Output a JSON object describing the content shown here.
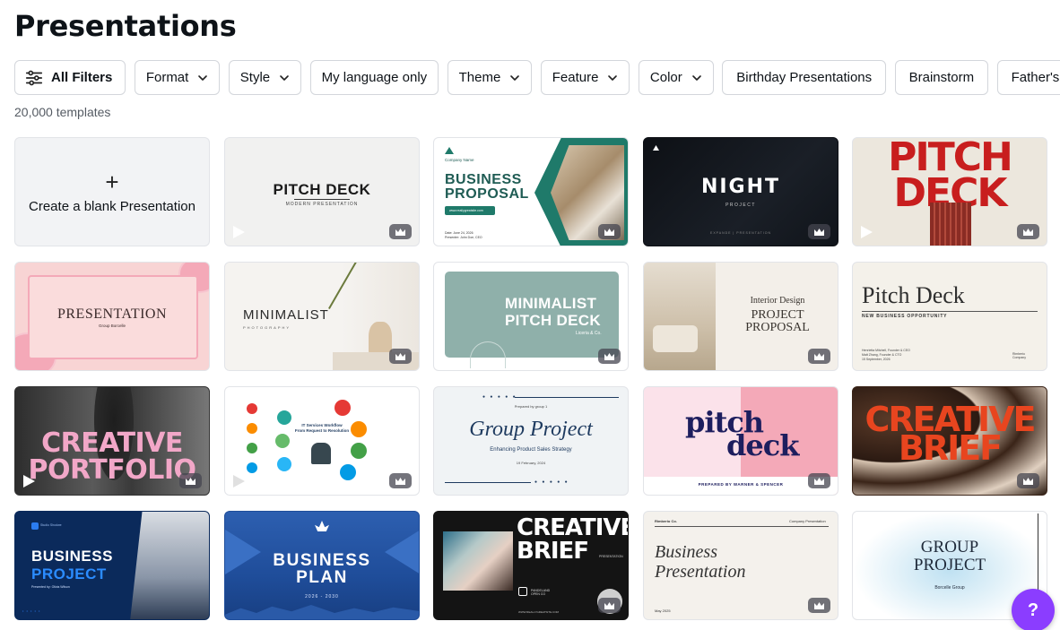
{
  "page": {
    "title": "Presentations",
    "count": "20,000 templates"
  },
  "filters": {
    "all_filters": "All Filters",
    "dropdowns": [
      "Format",
      "Style"
    ],
    "my_language": "My language only",
    "dropdowns2": [
      "Theme",
      "Feature",
      "Color"
    ],
    "chips": [
      "Birthday Presentations",
      "Brainstorm",
      "Father's D"
    ]
  },
  "blank_card": {
    "plus": "+",
    "label": "Create a blank Presentation"
  },
  "templates": {
    "pitch_deck_1": {
      "title": "PITCH DECK",
      "sub": "MODERN PRESENTATION"
    },
    "business_proposal": {
      "company": "Company Name",
      "title1": "BUSINESS",
      "title2": "PROPOSAL",
      "link": "www.reallygreatsite.com",
      "date": "Date: June 24, 2026",
      "presenter": "Presenter: John Doe, CEO"
    },
    "night": {
      "title": "NIGHT",
      "sub": "PROJECT",
      "footer": "EXPANDE | PRESENTATION"
    },
    "pitch_deck_red": {
      "line1": "PITCH",
      "line2": "DECK"
    },
    "presentation_pink": {
      "title": "PRESENTATION",
      "sub": "Group Borcelle"
    },
    "minimalist_photo": {
      "title": "MINIMALIST",
      "sub": "PHOTOGRAPHY"
    },
    "minimalist_pitch": {
      "line1": "MINIMALIST",
      "line2": "PITCH DECK",
      "sub": "Liceria & Co."
    },
    "interior": {
      "line1": "Interior Design",
      "line2": "PROJECT",
      "line3": "PROPOSAL"
    },
    "pitch_deck_serif": {
      "title": "Pitch Deck",
      "sub": "NEW BUSINESS OPPORTUNITY",
      "names": "Henrietta Mitchell, Founder & CEO",
      "names2": "Matt Zhang, Founder & CTO",
      "date": "15 September, 2026",
      "brand": "Rimberio Company"
    },
    "creative_portfolio": {
      "line1": "CREATIVE",
      "line2": "PORTFOLIO"
    },
    "it_workflow": {
      "title": "IT Services Workflow",
      "sub": "From Request to Resolution"
    },
    "group_project": {
      "prepared": "Prepared by group 1",
      "title": "Group Project",
      "sub": "Enhancing Product Sales Strategy",
      "date": "19 February, 2024"
    },
    "pitch_deck_pink": {
      "line1": "pitch",
      "line2": "deck",
      "footer": "PREPARED BY WARNER & SPENCER"
    },
    "creative_brief_red": {
      "line1": "CREATIVE",
      "line2": "BRIEF"
    },
    "business_project": {
      "line1": "BUSINESS",
      "line2": "PROJECT",
      "sub": "Presented by: Olivia Wilson",
      "brand": "Studio Shodwe"
    },
    "business_plan": {
      "line1": "BUSINESS",
      "line2": "PLAN",
      "years": "2026 - 2030"
    },
    "creative_brief_dark": {
      "line1": "CREATIVE",
      "line2": "BRIEF",
      "tag": "PRESENTATION",
      "brand": "PANDELAND OPEN CO",
      "url": "WWW.REALLYGREATSITE.COM"
    },
    "business_presentation": {
      "brand": "Rimberio Co.",
      "corner": "Company Presentation",
      "line1": "Business",
      "line2": "Presentation",
      "date": "May 2025"
    },
    "group_project_2": {
      "line1": "GROUP",
      "line2": "PROJECT",
      "sub": "Borcelle Group"
    }
  },
  "help": {
    "label": "?"
  }
}
